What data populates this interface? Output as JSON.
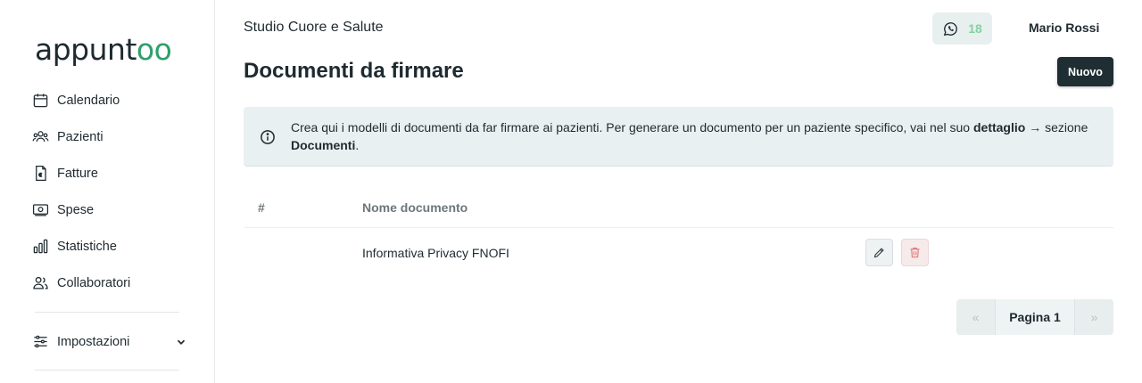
{
  "brand": {
    "logo_main": "appunt",
    "logo_accent": "oo",
    "accent_color": "#2ea06a"
  },
  "sidebar": {
    "items": [
      {
        "label": "Calendario",
        "icon": "calendar-icon"
      },
      {
        "label": "Pazienti",
        "icon": "users-icon"
      },
      {
        "label": "Fatture",
        "icon": "invoice-icon"
      },
      {
        "label": "Spese",
        "icon": "banknote-icon"
      },
      {
        "label": "Statistiche",
        "icon": "bar-chart-icon"
      },
      {
        "label": "Collaboratori",
        "icon": "collaborators-icon"
      }
    ],
    "settings_label": "Impostazioni"
  },
  "header": {
    "studio_name": "Studio Cuore e Salute",
    "whatsapp_count": "18",
    "user_name": "Mario Rossi"
  },
  "page": {
    "title": "Documenti da firmare",
    "new_button": "Nuovo"
  },
  "info": {
    "text_1": "Crea qui i modelli di documenti da far firmare ai pazienti. Per generare un documento per un paziente specifico, vai nel suo ",
    "bold_1": "dettaglio",
    "text_2": " → sezione ",
    "bold_2": "Documenti",
    "text_3": "."
  },
  "table": {
    "headers": [
      "#",
      "Nome documento"
    ],
    "rows": [
      {
        "number": "",
        "name": "Informativa Privacy FNOFI"
      }
    ]
  },
  "pagination": {
    "prev": "«",
    "current": "Pagina 1",
    "next": "»"
  }
}
